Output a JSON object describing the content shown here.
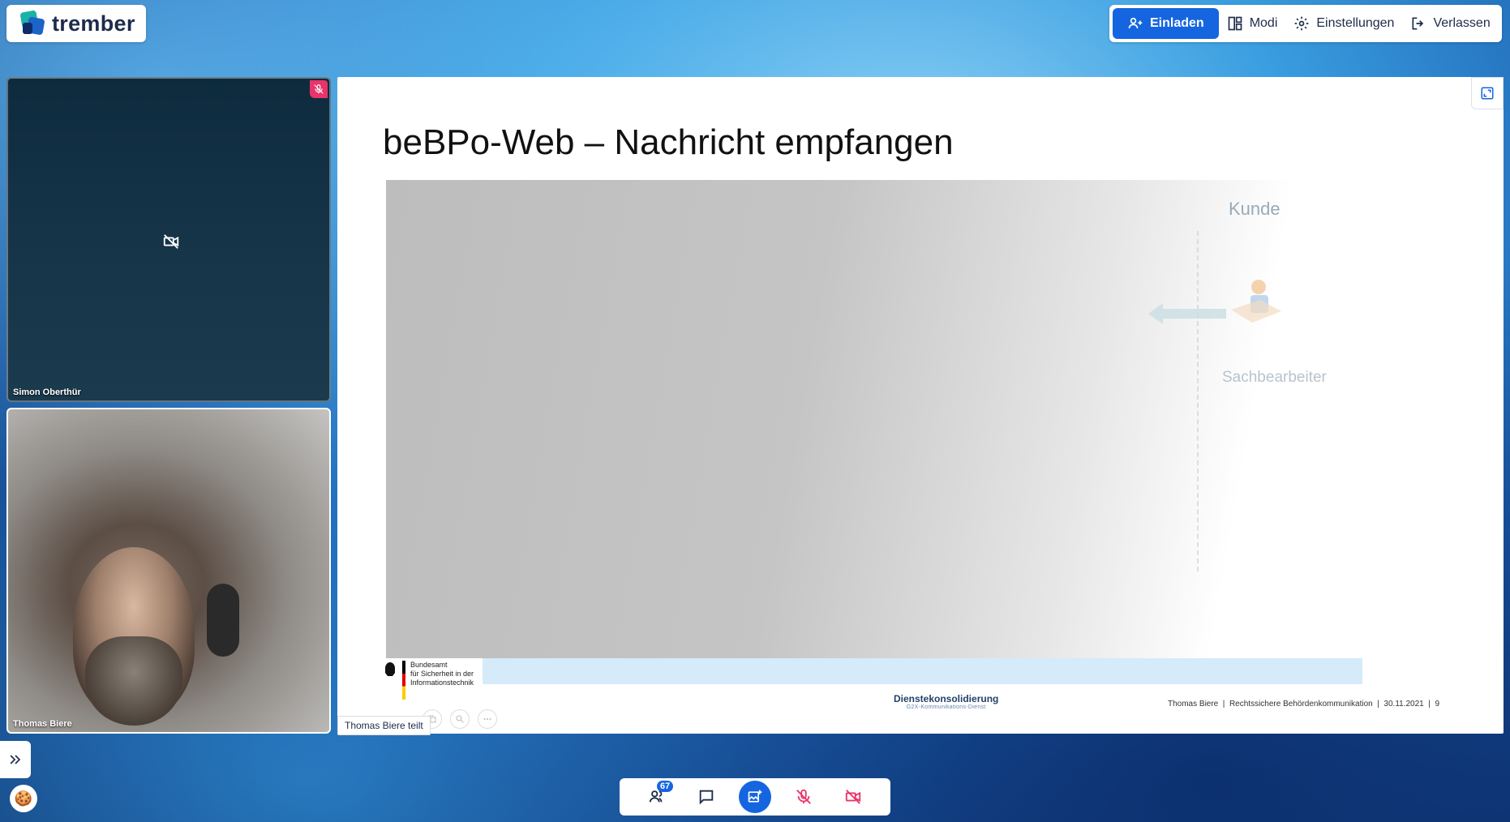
{
  "app": {
    "name": "trember"
  },
  "toolbar": {
    "invite_label": "Einladen",
    "modes_label": "Modi",
    "settings_label": "Einstellungen",
    "leave_label": "Verlassen"
  },
  "participants": [
    {
      "name": "Simon Oberthür",
      "camera": "off",
      "muted": true
    },
    {
      "name": "Thomas Biere",
      "camera": "on",
      "muted": false
    }
  ],
  "presentation": {
    "title": "beBPo-Web – Nachricht empfangen",
    "diagram": {
      "kunde": "Kunde",
      "sachbearbeiter": "Sachbearbeiter"
    },
    "bsi_lines": [
      "Bundesamt",
      "für Sicherheit in der",
      "Informationstechnik"
    ],
    "dk_title": "Dienstekonsolidierung",
    "dk_subtitle": "G2X-Kommunikations-Dienst",
    "footer": "Thomas Biere  |  Rechtssichere Behördenkommunikation  |  30.11.2021  |  9",
    "sharing_label": "Thomas Biere teilt"
  },
  "bottom_bar": {
    "participants_count": "67"
  },
  "colors": {
    "accent": "#1565e0",
    "mute": "#e8346a"
  }
}
